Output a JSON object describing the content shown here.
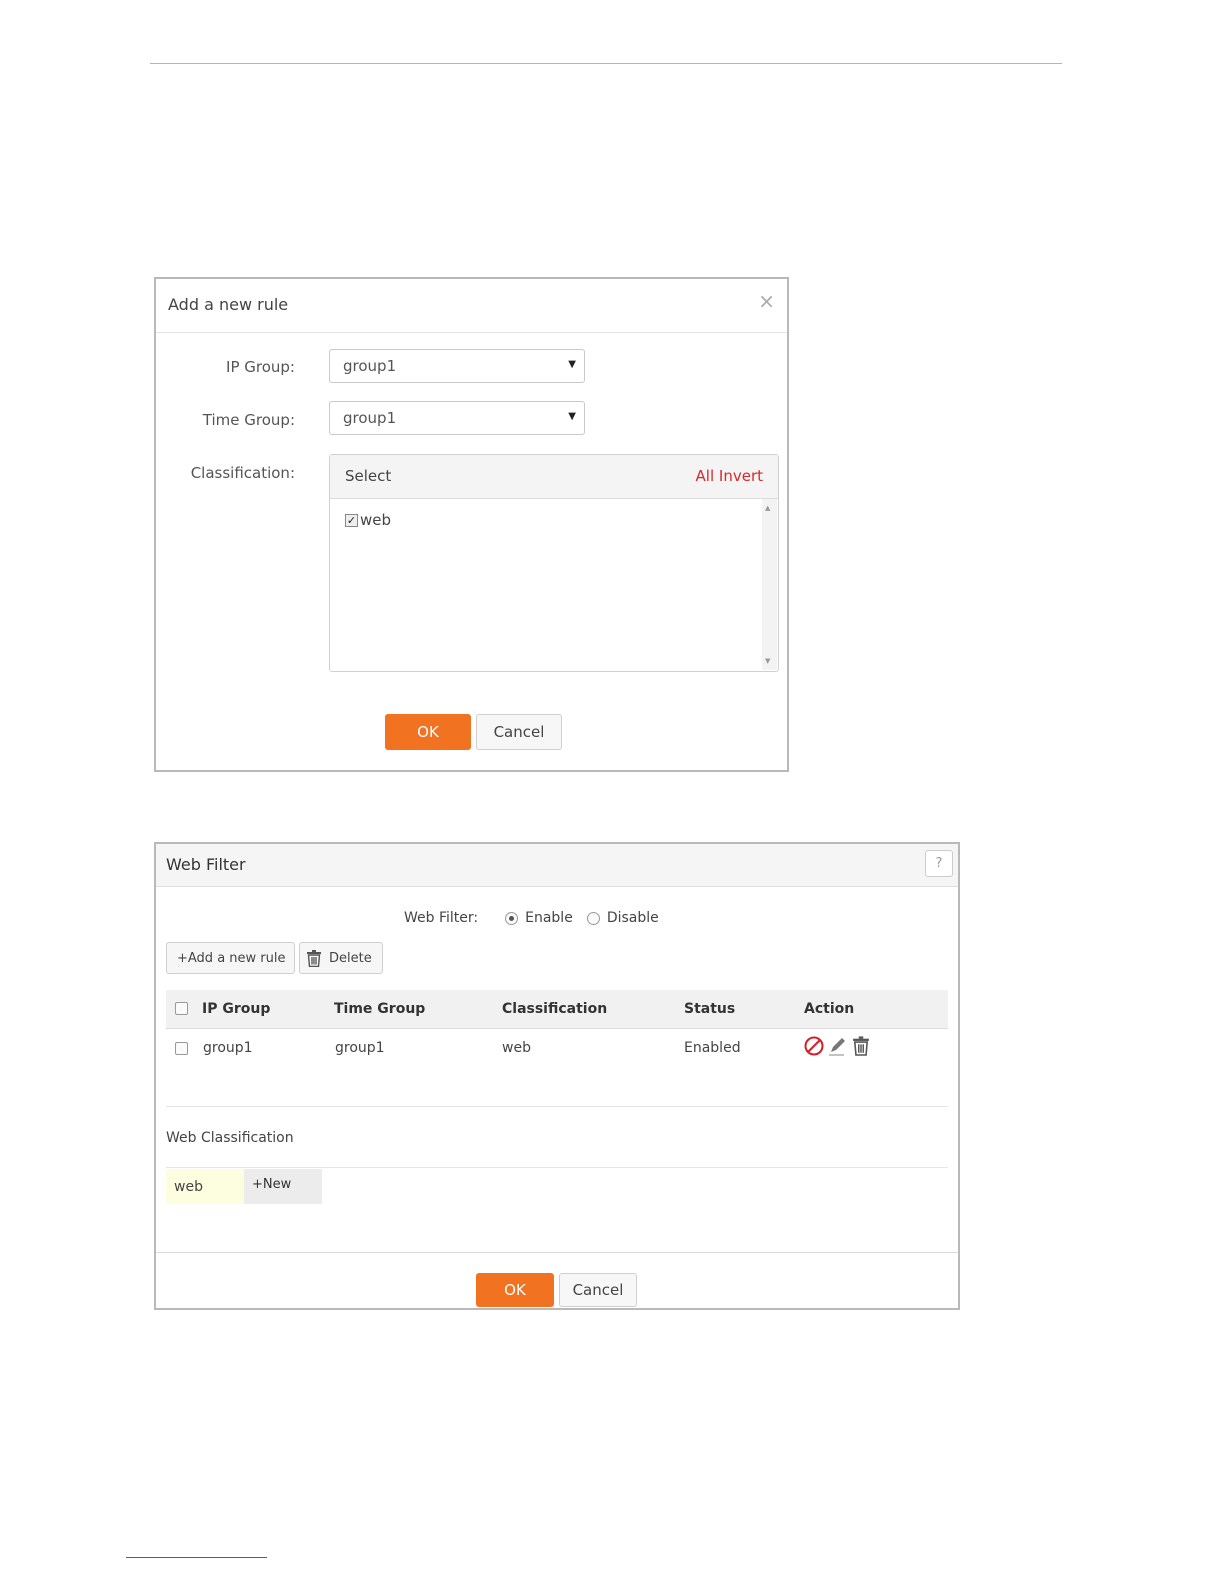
{
  "dialog": {
    "title": "Add a new rule",
    "close_icon": "×",
    "ip_group_label": "IP Group:",
    "ip_group_value": "group1",
    "time_group_label": "Time Group:",
    "time_group_value": "group1",
    "classification_label": "Classification:",
    "select_label": "Select",
    "invert_label": "All Invert",
    "items": [
      {
        "label": "web",
        "checked": true
      }
    ],
    "ok_label": "OK",
    "cancel_label": "Cancel"
  },
  "panel": {
    "title": "Web Filter",
    "help_label": "?",
    "web_filter_label": "Web Filter:",
    "enable_label": "Enable",
    "disable_label": "Disable",
    "web_filter_state": "Enable",
    "add_rule_label": "+Add a new rule",
    "delete_label": "Delete",
    "table": {
      "columns": [
        "IP Group",
        "Time Group",
        "Classification",
        "Status",
        "Action"
      ],
      "rows": [
        {
          "ip_group": "group1",
          "time_group": "group1",
          "classification": "web",
          "status": "Enabled",
          "actions": [
            "disable-icon",
            "edit-icon",
            "trash-icon"
          ]
        }
      ]
    },
    "web_classification_title": "Web Classification",
    "web_tag": "web",
    "new_tag": "+New",
    "ok_label": "OK",
    "cancel_label": "Cancel"
  },
  "colors": {
    "accent": "#f17322",
    "invert_red": "#d42a2a",
    "disable_icon_red": "#d0202a"
  }
}
